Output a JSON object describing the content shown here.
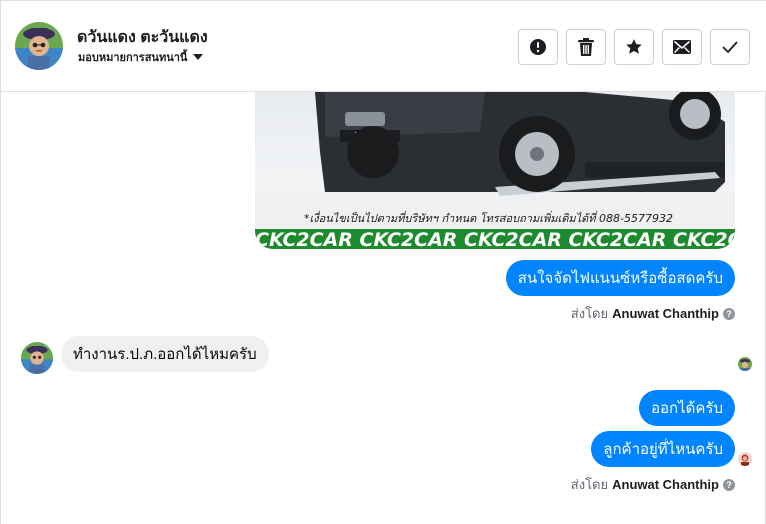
{
  "header": {
    "title": "ดวันแดง ตะวันแดง",
    "subtitle": "มอบหมายการสนทนานี้",
    "actions": [
      {
        "name": "report-button",
        "icon": "alert-circle-icon"
      },
      {
        "name": "delete-button",
        "icon": "trash-icon"
      },
      {
        "name": "star-button",
        "icon": "star-icon"
      },
      {
        "name": "mark-unread-button",
        "icon": "envelope-icon"
      },
      {
        "name": "mark-done-button",
        "icon": "check-icon"
      }
    ]
  },
  "image": {
    "caption": "*เงื่อนไขเป็นไปตามที่บริษัทฯ กำหนด โทรสอบถามเพิ่มเติมได้ที่ 088-5577932",
    "banner": "CKC2CAR CKC2CAR CKC2CAR CKC2CAR CKC2CAR CKC2"
  },
  "messages": {
    "m1": "สนใจจัดไฟแนนซ์หรือซื้อสดครับ",
    "m2": "ทำงานร.ป.ภ.ออกได้ไหมครับ",
    "m3": "ออกได้ครับ",
    "m4": "ลูกค้าอยู่ที่ไหนครับ"
  },
  "sent_by": {
    "prefix": "ส่งโดย",
    "name": "Anuwat Chanthip",
    "help": "?"
  },
  "colors": {
    "outgoing": "#0084ff",
    "incoming": "#f1f0f0",
    "banner": "#1e8a2e"
  }
}
